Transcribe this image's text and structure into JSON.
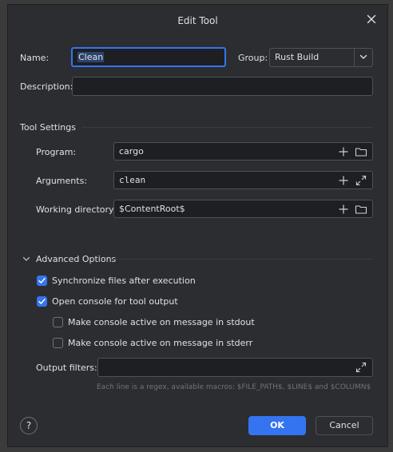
{
  "dialog": {
    "title": "Edit Tool",
    "close_icon": "close-icon"
  },
  "name": {
    "label": "Name:",
    "value": "Clean"
  },
  "group": {
    "label": "Group:",
    "value": "Rust Build"
  },
  "description": {
    "label": "Description:",
    "value": ""
  },
  "tool_settings": {
    "title": "Tool Settings",
    "program": {
      "label": "Program:",
      "value": "cargo"
    },
    "arguments": {
      "label": "Arguments:",
      "value": "clean"
    },
    "working_directory": {
      "label": "Working directory:",
      "value": "$ContentRoot$"
    }
  },
  "advanced": {
    "title": "Advanced Options",
    "expanded": true,
    "options": [
      {
        "label": "Synchronize files after execution",
        "checked": true
      },
      {
        "label": "Open console for tool output",
        "checked": true
      },
      {
        "label": "Make console active on message in stdout",
        "checked": false
      },
      {
        "label": "Make console active on message in stderr",
        "checked": false
      }
    ],
    "output_filters": {
      "label": "Output filters:",
      "value": "",
      "hint": "Each line is a regex, available macros: $FILE_PATH$, $LINE$ and $COLUMN$"
    }
  },
  "footer": {
    "help_label": "?",
    "ok_label": "OK",
    "cancel_label": "Cancel"
  },
  "colors": {
    "accent": "#3574f0",
    "background": "#2b2d30",
    "field": "#1e1f22"
  }
}
